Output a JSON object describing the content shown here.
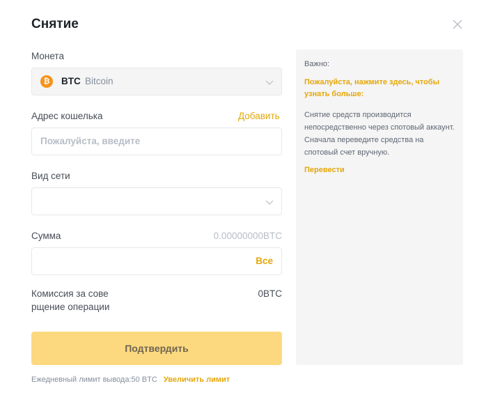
{
  "title": "Снятие",
  "coin": {
    "label": "Монета",
    "symbol": "BTC",
    "name": "Bitcoin",
    "icon": "bitcoin-icon",
    "icon_glyph": "₿",
    "icon_color": "#f7931a"
  },
  "wallet": {
    "label": "Адрес кошелька",
    "add_label": "Добавить",
    "placeholder": "Пожалуйста, введите"
  },
  "network": {
    "label": "Вид сети",
    "value": ""
  },
  "amount": {
    "label": "Сумма",
    "available": "0.00000000BTC",
    "all_label": "Все",
    "value": ""
  },
  "fee": {
    "label": "Комиссия за сове рщение операции",
    "value": "0BTC"
  },
  "confirm_label": "Подтвердить",
  "limit": {
    "text": "Ежедневный лимит вывода:50 BTC",
    "increase_label": "Увеличить лимит"
  },
  "info": {
    "important_label": "Важно:",
    "learn_more": "Пожалуйста, нажмите здесь, чтобы узнать больше:",
    "description": "Снятие средств производится непосредственно через спотовый аккаунт. Сначала переведите средства на спотовый счет вручную.",
    "transfer_label": "Перевести"
  },
  "colors": {
    "accent": "#e5a70a",
    "confirm_bg": "#fcd97f"
  }
}
